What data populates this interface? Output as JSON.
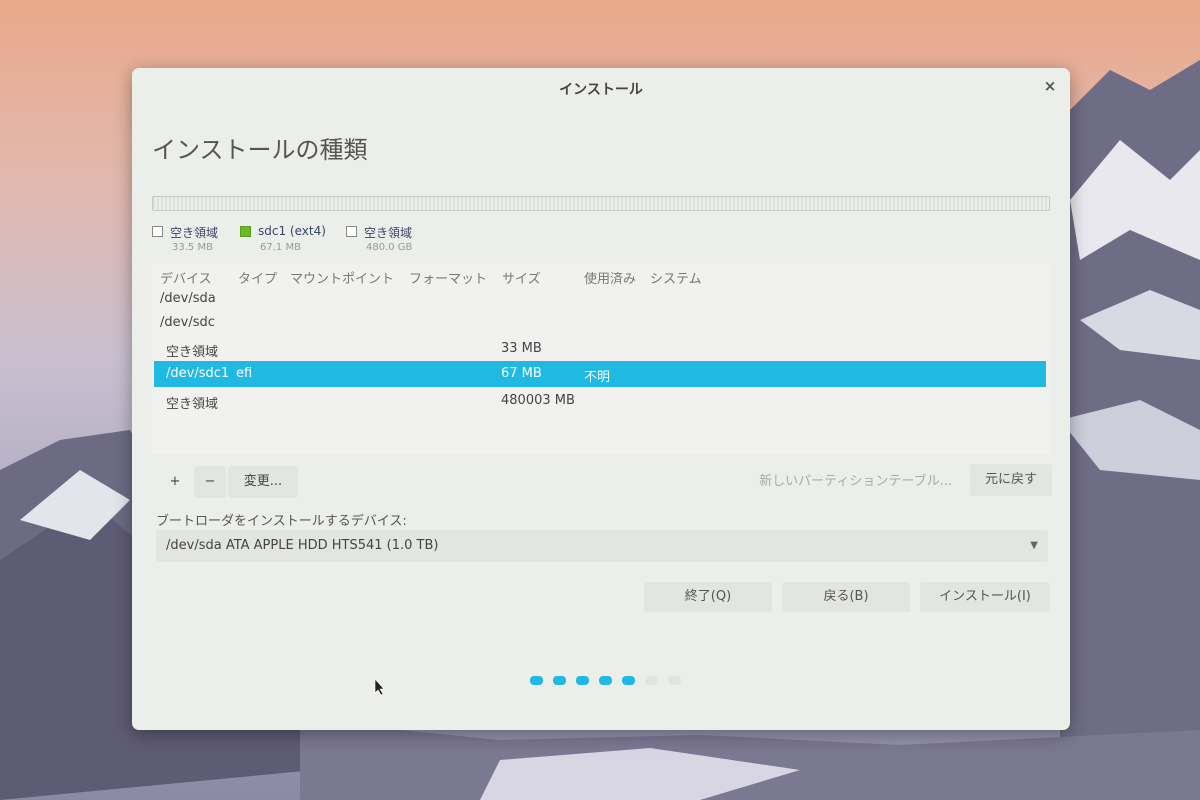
{
  "window": {
    "title": "インストール",
    "close_glyph": "×"
  },
  "page": {
    "heading": "インストールの種類"
  },
  "legend": [
    {
      "name": "空き領域",
      "size": "33.5 MB",
      "swatch": "#ffffff"
    },
    {
      "name": "sdc1 (ext4)",
      "size": "67.1 MB",
      "swatch": "#6cbb24"
    },
    {
      "name": "空き領域",
      "size": "480.0 GB",
      "swatch": "#ffffff"
    }
  ],
  "table": {
    "headers": [
      "デバイス",
      "タイプ",
      "マウントポイント",
      "フォーマット",
      "サイズ",
      "使用済み",
      "システム"
    ],
    "rows": [
      {
        "device": "/dev/sda",
        "type": "",
        "size": "",
        "used": ""
      },
      {
        "device": "/dev/sdc",
        "type": "",
        "size": "",
        "used": ""
      },
      {
        "device": "空き領域",
        "type": "",
        "size": "33 MB",
        "used": ""
      },
      {
        "device": "/dev/sdc1",
        "type": "efi",
        "size": "67 MB",
        "used": "不明",
        "selected": true
      },
      {
        "device": "空き領域",
        "type": "",
        "size": "480003 MB",
        "used": ""
      }
    ]
  },
  "toolbar": {
    "add": "+",
    "remove": "−",
    "change": "変更...",
    "new_table": "新しいパーティションテーブル...",
    "revert": "元に戻す"
  },
  "bootloader": {
    "label": "ブートローダをインストールするデバイス:",
    "value": "/dev/sda   ATA APPLE HDD HTS541 (1.0 TB)"
  },
  "buttons": {
    "quit": "終了(Q)",
    "back": "戻る(B)",
    "install": "インストール(I)"
  },
  "progress": {
    "total": 7,
    "current": 5
  },
  "colors": {
    "accent": "#1fb9e2",
    "ext4": "#6cbb24"
  }
}
